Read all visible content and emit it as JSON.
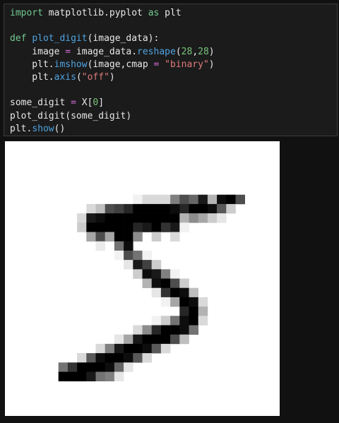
{
  "code_lines": [
    [
      {
        "t": "import",
        "c": "kw"
      },
      {
        "t": " matplotlib.pyplot ",
        "c": "n"
      },
      {
        "t": "as",
        "c": "kw"
      },
      {
        "t": " plt",
        "c": "n"
      }
    ],
    [],
    [
      {
        "t": "def",
        "c": "kw"
      },
      {
        "t": " ",
        "c": "n"
      },
      {
        "t": "plot_digit",
        "c": "fn"
      },
      {
        "t": "(image_data):",
        "c": "n"
      }
    ],
    [
      {
        "t": "    image ",
        "c": "n"
      },
      {
        "t": "=",
        "c": "op"
      },
      {
        "t": " image_data.",
        "c": "n"
      },
      {
        "t": "reshape",
        "c": "fn"
      },
      {
        "t": "(",
        "c": "n"
      },
      {
        "t": "28",
        "c": "num"
      },
      {
        "t": ",",
        "c": "n"
      },
      {
        "t": "28",
        "c": "num"
      },
      {
        "t": ")",
        "c": "n"
      }
    ],
    [
      {
        "t": "    plt.",
        "c": "n"
      },
      {
        "t": "imshow",
        "c": "fn"
      },
      {
        "t": "(image,cmap ",
        "c": "n"
      },
      {
        "t": "=",
        "c": "op"
      },
      {
        "t": " ",
        "c": "n"
      },
      {
        "t": "\"binary\"",
        "c": "str"
      },
      {
        "t": ")",
        "c": "n"
      }
    ],
    [
      {
        "t": "    plt.",
        "c": "n"
      },
      {
        "t": "axis",
        "c": "fn"
      },
      {
        "t": "(",
        "c": "n"
      },
      {
        "t": "\"off\"",
        "c": "str"
      },
      {
        "t": ")",
        "c": "n"
      }
    ],
    [],
    [
      {
        "t": "some_digit ",
        "c": "n"
      },
      {
        "t": "=",
        "c": "op"
      },
      {
        "t": " X[",
        "c": "n"
      },
      {
        "t": "0",
        "c": "num"
      },
      {
        "t": "]",
        "c": "n"
      }
    ],
    [
      {
        "t": "plot_digit(some_digit)",
        "c": "n"
      }
    ],
    [
      {
        "t": "plt.",
        "c": "n"
      },
      {
        "t": "show",
        "c": "fn"
      },
      {
        "t": "()",
        "c": "n"
      }
    ]
  ],
  "syntax_colors": {
    "kw": "#73c991",
    "fn": "#4fa3e0",
    "num": "#7ac47a",
    "str": "#e07a7a",
    "op": "#d86bd8",
    "n": "#e8e8e8"
  },
  "digit_image": {
    "size": 28,
    "cmap": "binary",
    "axis": "off",
    "pixels": [
      [
        0,
        0,
        0,
        0,
        0,
        0,
        0,
        0,
        0,
        0,
        0,
        0,
        0,
        0,
        0,
        0,
        0,
        0,
        0,
        0,
        0,
        0,
        0,
        0,
        0,
        0,
        0,
        0
      ],
      [
        0,
        0,
        0,
        0,
        0,
        0,
        0,
        0,
        0,
        0,
        0,
        0,
        0,
        0,
        0,
        0,
        0,
        0,
        0,
        0,
        0,
        0,
        0,
        0,
        0,
        0,
        0,
        0
      ],
      [
        0,
        0,
        0,
        0,
        0,
        0,
        0,
        0,
        0,
        0,
        0,
        0,
        0,
        0,
        0,
        0,
        0,
        0,
        0,
        0,
        0,
        0,
        0,
        0,
        0,
        0,
        0,
        0
      ],
      [
        0,
        0,
        0,
        0,
        0,
        0,
        0,
        0,
        0,
        0,
        0,
        0,
        0,
        0,
        0,
        0,
        0,
        0,
        0,
        0,
        0,
        0,
        0,
        0,
        0,
        0,
        0,
        0
      ],
      [
        0,
        0,
        0,
        0,
        0,
        0,
        0,
        0,
        0,
        0,
        0,
        0,
        0,
        0,
        0,
        0,
        0,
        0,
        0,
        0,
        0,
        0,
        0,
        0,
        0,
        0,
        0,
        0
      ],
      [
        0,
        0,
        0,
        0,
        0,
        0,
        0,
        0,
        0,
        0,
        0,
        0,
        0,
        5,
        15,
        15,
        15,
        50,
        70,
        60,
        90,
        30,
        95,
        100,
        70,
        0,
        0,
        0
      ],
      [
        0,
        0,
        0,
        0,
        0,
        0,
        0,
        0,
        15,
        25,
        70,
        75,
        85,
        100,
        100,
        100,
        100,
        95,
        85,
        100,
        100,
        95,
        65,
        20,
        0,
        0,
        0,
        0
      ],
      [
        0,
        0,
        0,
        0,
        0,
        0,
        0,
        15,
        90,
        95,
        100,
        100,
        100,
        100,
        100,
        100,
        100,
        100,
        30,
        45,
        35,
        20,
        10,
        0,
        0,
        0,
        0,
        0
      ],
      [
        0,
        0,
        0,
        0,
        0,
        0,
        0,
        20,
        100,
        100,
        100,
        100,
        100,
        85,
        90,
        100,
        80,
        90,
        5,
        0,
        0,
        0,
        0,
        0,
        0,
        0,
        0,
        0
      ],
      [
        0,
        0,
        0,
        0,
        0,
        0,
        0,
        0,
        35,
        70,
        35,
        100,
        100,
        45,
        0,
        20,
        0,
        15,
        0,
        0,
        0,
        0,
        0,
        0,
        0,
        0,
        0,
        0
      ],
      [
        0,
        0,
        0,
        0,
        0,
        0,
        0,
        0,
        0,
        8,
        0,
        55,
        95,
        0,
        0,
        0,
        0,
        0,
        0,
        0,
        0,
        0,
        0,
        0,
        0,
        0,
        0,
        0
      ],
      [
        0,
        0,
        0,
        0,
        0,
        0,
        0,
        0,
        0,
        0,
        0,
        5,
        70,
        55,
        5,
        0,
        0,
        0,
        0,
        0,
        0,
        0,
        0,
        0,
        0,
        0,
        0,
        0
      ],
      [
        0,
        0,
        0,
        0,
        0,
        0,
        0,
        0,
        0,
        0,
        0,
        0,
        10,
        90,
        75,
        20,
        0,
        0,
        0,
        0,
        0,
        0,
        0,
        0,
        0,
        0,
        0,
        0
      ],
      [
        0,
        0,
        0,
        0,
        0,
        0,
        0,
        0,
        0,
        0,
        0,
        0,
        0,
        20,
        95,
        90,
        50,
        5,
        0,
        0,
        0,
        0,
        0,
        0,
        0,
        0,
        0,
        0
      ],
      [
        0,
        0,
        0,
        0,
        0,
        0,
        0,
        0,
        0,
        0,
        0,
        0,
        0,
        0,
        30,
        95,
        100,
        70,
        20,
        0,
        0,
        0,
        0,
        0,
        0,
        0,
        0,
        0
      ],
      [
        0,
        0,
        0,
        0,
        0,
        0,
        0,
        0,
        0,
        0,
        0,
        0,
        0,
        0,
        0,
        10,
        80,
        100,
        95,
        25,
        0,
        0,
        0,
        0,
        0,
        0,
        0,
        0
      ],
      [
        0,
        0,
        0,
        0,
        0,
        0,
        0,
        0,
        0,
        0,
        0,
        0,
        0,
        0,
        0,
        0,
        5,
        35,
        100,
        95,
        15,
        0,
        0,
        0,
        0,
        0,
        0,
        0
      ],
      [
        0,
        0,
        0,
        0,
        0,
        0,
        0,
        0,
        0,
        0,
        0,
        0,
        0,
        0,
        0,
        0,
        0,
        0,
        85,
        100,
        30,
        0,
        0,
        0,
        0,
        0,
        0,
        0
      ],
      [
        0,
        0,
        0,
        0,
        0,
        0,
        0,
        0,
        0,
        0,
        0,
        0,
        0,
        0,
        0,
        5,
        20,
        55,
        95,
        100,
        15,
        0,
        0,
        0,
        0,
        0,
        0,
        0
      ],
      [
        0,
        0,
        0,
        0,
        0,
        0,
        0,
        0,
        0,
        0,
        0,
        0,
        0,
        15,
        45,
        85,
        100,
        100,
        95,
        55,
        0,
        0,
        0,
        0,
        0,
        0,
        0,
        0
      ],
      [
        0,
        0,
        0,
        0,
        0,
        0,
        0,
        0,
        0,
        0,
        0,
        10,
        35,
        90,
        100,
        100,
        100,
        70,
        25,
        0,
        0,
        0,
        0,
        0,
        0,
        0,
        0,
        0
      ],
      [
        0,
        0,
        0,
        0,
        0,
        0,
        0,
        0,
        0,
        15,
        50,
        90,
        100,
        100,
        95,
        65,
        15,
        0,
        0,
        0,
        0,
        0,
        0,
        0,
        0,
        0,
        0,
        0
      ],
      [
        0,
        0,
        0,
        0,
        0,
        0,
        0,
        15,
        65,
        95,
        100,
        100,
        95,
        65,
        15,
        0,
        0,
        0,
        0,
        0,
        0,
        0,
        0,
        0,
        0,
        0,
        0,
        0
      ],
      [
        0,
        0,
        0,
        0,
        0,
        55,
        80,
        100,
        100,
        100,
        95,
        60,
        10,
        0,
        0,
        0,
        0,
        0,
        0,
        0,
        0,
        0,
        0,
        0,
        0,
        0,
        0,
        0
      ],
      [
        0,
        0,
        0,
        0,
        0,
        100,
        100,
        100,
        90,
        55,
        50,
        10,
        0,
        0,
        0,
        0,
        0,
        0,
        0,
        0,
        0,
        0,
        0,
        0,
        0,
        0,
        0,
        0
      ],
      [
        0,
        0,
        0,
        0,
        0,
        0,
        0,
        0,
        0,
        0,
        0,
        0,
        0,
        0,
        0,
        0,
        0,
        0,
        0,
        0,
        0,
        0,
        0,
        0,
        0,
        0,
        0,
        0
      ],
      [
        0,
        0,
        0,
        0,
        0,
        0,
        0,
        0,
        0,
        0,
        0,
        0,
        0,
        0,
        0,
        0,
        0,
        0,
        0,
        0,
        0,
        0,
        0,
        0,
        0,
        0,
        0,
        0
      ],
      [
        0,
        0,
        0,
        0,
        0,
        0,
        0,
        0,
        0,
        0,
        0,
        0,
        0,
        0,
        0,
        0,
        0,
        0,
        0,
        0,
        0,
        0,
        0,
        0,
        0,
        0,
        0,
        0
      ]
    ]
  }
}
